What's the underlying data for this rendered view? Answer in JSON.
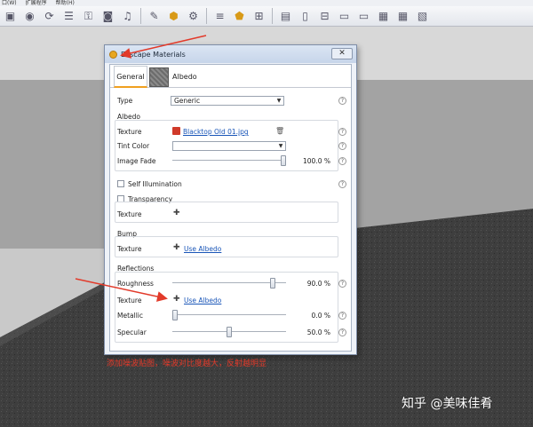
{
  "menubar": {
    "items": [
      "口(W)",
      "扩展程序",
      "帮助(H)"
    ]
  },
  "toolbar": {
    "icons": [
      "tray-icon",
      "sphere-icon",
      "rotate-icon",
      "layers-icon",
      "key-icon",
      "camera-icon",
      "speaker-icon",
      "brush-icon",
      "badge-icon",
      "gear-icon",
      "sliders-icon",
      "shield-icon",
      "cart-icon",
      "window-icon",
      "file-icon",
      "layout-icon",
      "monitor-icon",
      "monitor2-icon",
      "image-icon",
      "image2-icon",
      "map-icon"
    ]
  },
  "dialog": {
    "title": "Enscape Materials",
    "close": "✕",
    "tabs": {
      "general": "General",
      "albedo": "Albedo"
    },
    "type": {
      "label": "Type",
      "value": "Generic"
    },
    "albedo": {
      "section": "Albedo",
      "texture_label": "Texture",
      "texture_file": "Blacktop Old 01.jpg",
      "tint_label": "Tint Color",
      "fade_label": "Image Fade",
      "fade_value": "100.0 %",
      "fade_fraction": 1.0
    },
    "self_illumination": "Self Illumination",
    "transparency": {
      "label": "Transparency",
      "texture_label": "Texture"
    },
    "bump": {
      "section": "Bump",
      "texture_label": "Texture",
      "texture_value": "Use Albedo"
    },
    "reflections": {
      "section": "Reflections",
      "roughness_label": "Roughness",
      "roughness_value": "90.0 %",
      "roughness_fraction": 0.9,
      "texture_label": "Texture",
      "texture_value": "Use Albedo",
      "metallic_label": "Metallic",
      "metallic_value": "0.0 %",
      "metallic_fraction": 0.0,
      "specular_label": "Specular",
      "specular_value": "50.0 %",
      "specular_fraction": 0.5
    },
    "help": "?"
  },
  "annotation": {
    "text": "添加噪波贴图，噪波对比度越大，反射越明显",
    "color": "#e23a2a"
  },
  "watermark": "知乎 @美味佳肴"
}
